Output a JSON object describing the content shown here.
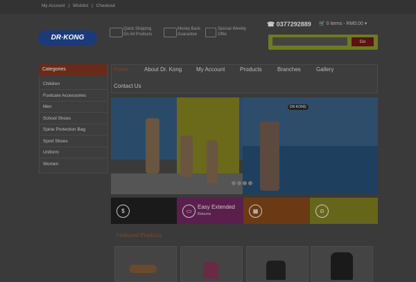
{
  "topbar": {
    "links": [
      "My Account",
      "Wishlist",
      "Checkout"
    ],
    "separator": "|"
  },
  "header": {
    "logo_text": "DR·KONG",
    "features": [
      {
        "icon": "truck-icon",
        "text": "Quick Shipping On All Products"
      },
      {
        "icon": "money-icon",
        "text": "Money Back Guarantee"
      },
      {
        "icon": "gift-icon",
        "text": "Special Weekly Offer"
      }
    ],
    "phone": "0377292889",
    "phone_icon": "phone-icon",
    "cart_text": "0 items - RM0.00",
    "search_placeholder": "",
    "search_button": "Go"
  },
  "sidebar": {
    "heading": "Categories",
    "items": [
      "Children",
      "Footcare Accessories",
      "Men",
      "School Shoes",
      "Spine Protection Bag",
      "Sport Shoes",
      "Uniform",
      "Women"
    ]
  },
  "nav": {
    "items": [
      "Home",
      "About Dr. Kong",
      "My Account",
      "Products",
      "Branches",
      "Gallery",
      "Contact Us"
    ],
    "active": "Home"
  },
  "banner": {
    "slide_count": 4,
    "badge": "DR·KONG"
  },
  "tiles": [
    {
      "icon": "$",
      "title": "",
      "subtitle": "",
      "color": "#1a1a1a"
    },
    {
      "icon": "▭",
      "title": "Easy Extended",
      "subtitle": "Returns",
      "color": "#5a1f4d"
    },
    {
      "icon": "▦",
      "title": "",
      "subtitle": "",
      "color": "#6b3a14"
    },
    {
      "icon": "⊙",
      "title": "",
      "subtitle": "",
      "color": "#66661a"
    }
  ],
  "featured": {
    "title": "Featured Products"
  }
}
